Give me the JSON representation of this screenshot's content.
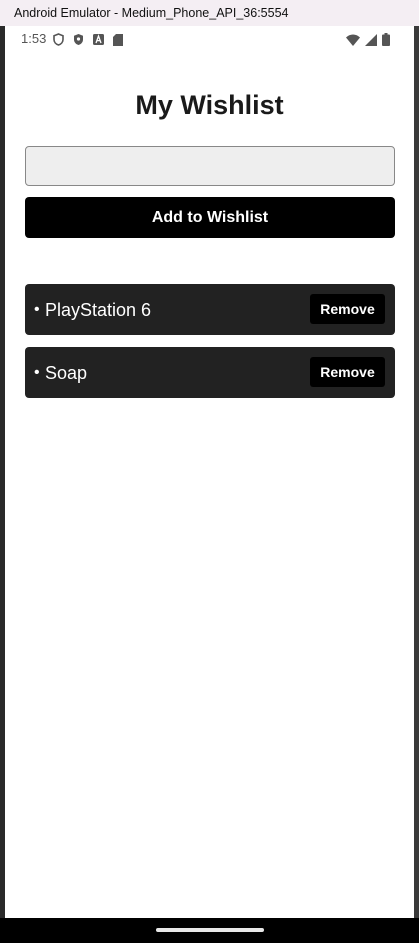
{
  "window": {
    "title": "Android Emulator - Medium_Phone_API_36:5554"
  },
  "status_bar": {
    "time": "1:53",
    "left_icons": [
      "shield-outline-icon",
      "shield-filled-icon",
      "font-a-icon",
      "sd-card-icon"
    ],
    "right_icons": [
      "wifi-icon",
      "signal-icon",
      "battery-icon"
    ]
  },
  "app": {
    "title": "My Wishlist",
    "input": {
      "value": "",
      "placeholder": ""
    },
    "add_button_label": "Add to Wishlist",
    "items": [
      {
        "bullet": "•",
        "name": "PlayStation 6",
        "remove_label": "Remove"
      },
      {
        "bullet": "•",
        "name": "Soap",
        "remove_label": "Remove"
      }
    ]
  },
  "colors": {
    "button_bg": "#000000",
    "item_bg": "#222222",
    "input_bg": "#eeeeee",
    "title_bar_bg": "#f4eef3"
  }
}
